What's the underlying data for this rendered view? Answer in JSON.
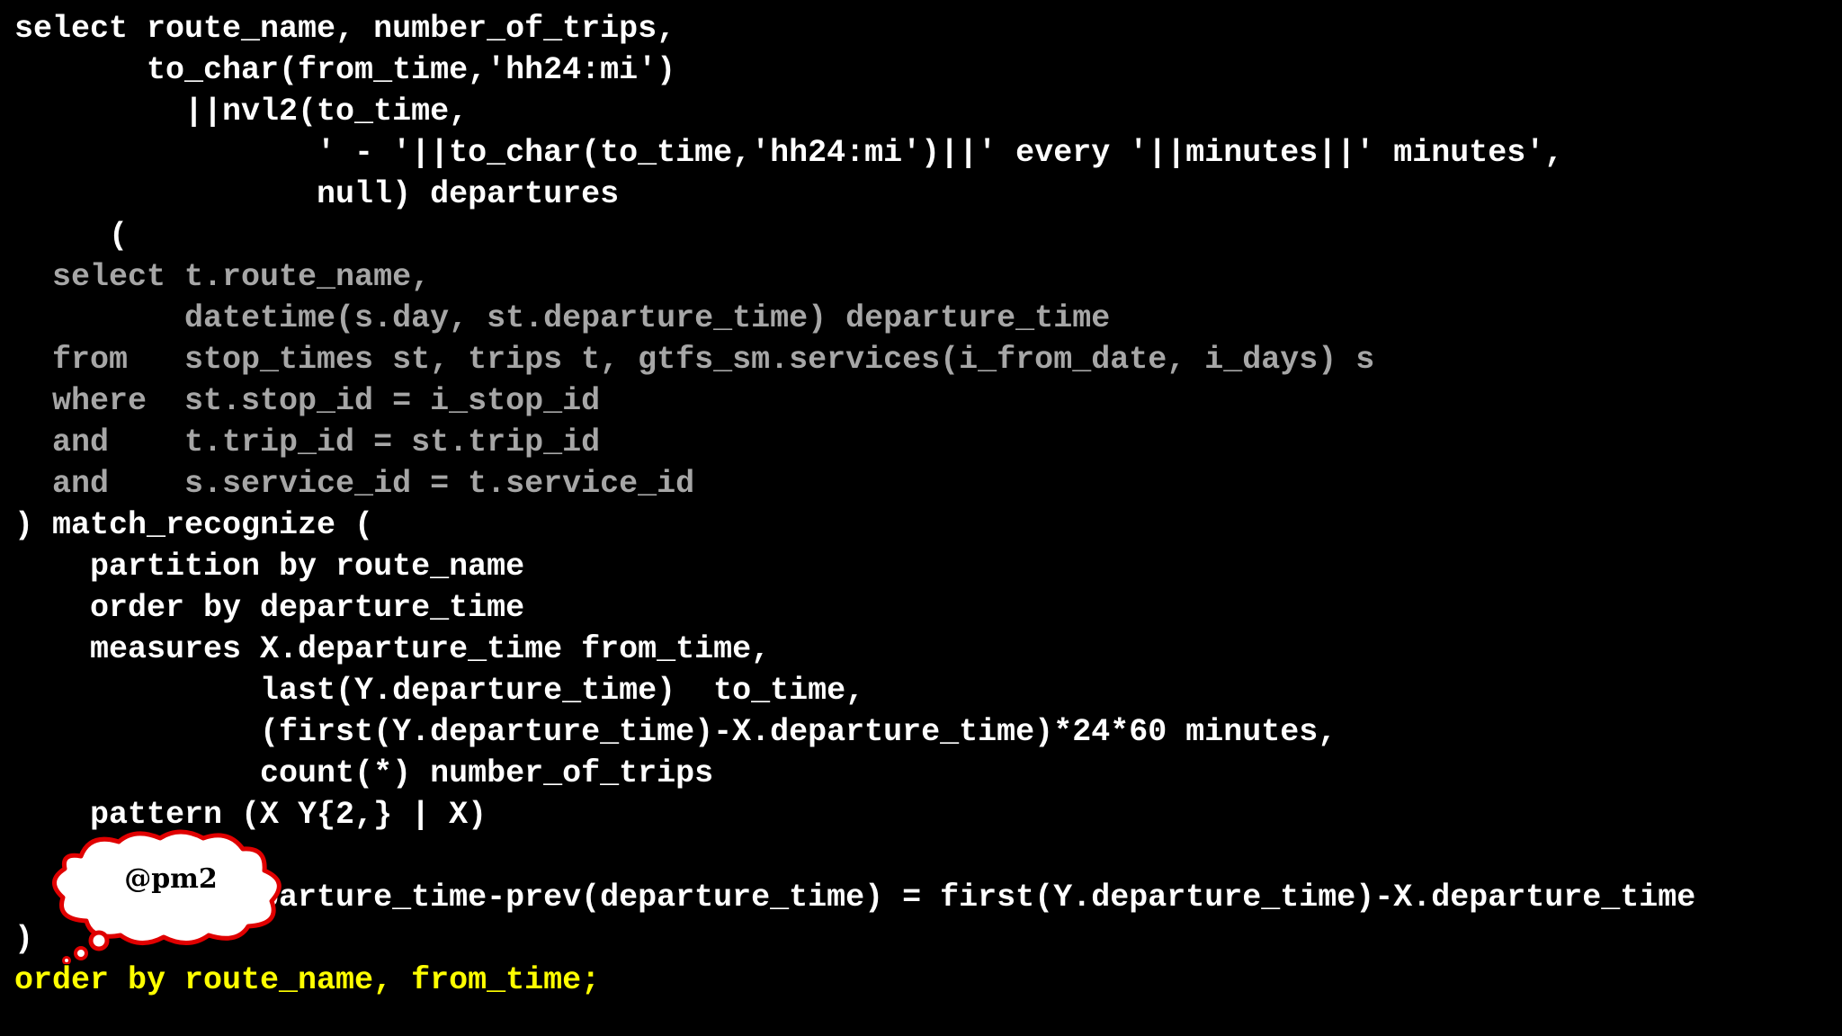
{
  "sql": {
    "lines": [
      "select route_name, number_of_trips,",
      "       to_char(from_time,'hh24:mi')",
      "         ||nvl2(to_time,",
      "                ' - '||to_char(to_time,'hh24:mi')||' every '||minutes||' minutes',",
      "                null) departures",
      "     (",
      "  select t.route_name,",
      "         datetime(s.day, st.departure_time) departure_time",
      "  from   stop_times st, trips t, gtfs_sm.services(i_from_date, i_days) s",
      "  where  st.stop_id = i_stop_id",
      "  and    t.trip_id = st.trip_id",
      "  and    s.service_id = t.service_id",
      ") match_recognize (",
      "    partition by route_name",
      "    order by departure_time",
      "    measures X.departure_time from_time,",
      "             last(Y.departure_time)  to_time,",
      "             (first(Y.departure_time)-X.departure_time)*24*60 minutes,",
      "             count(*) number_of_trips",
      "    pattern (X Y{2,} | X)",
      "",
      "             parture_time-prev(departure_time) = first(Y.departure_time)-X.departure_time",
      ")",
      "order by route_name, from_time;"
    ]
  },
  "callout": {
    "label": "@pm2"
  },
  "colors": {
    "background": "#000000",
    "code_text": "#ffffff",
    "subquery_text": "#a6a6a6",
    "highlight_text": "#ffff00",
    "callout_fill": "#ffffff",
    "callout_border": "#e00000"
  }
}
